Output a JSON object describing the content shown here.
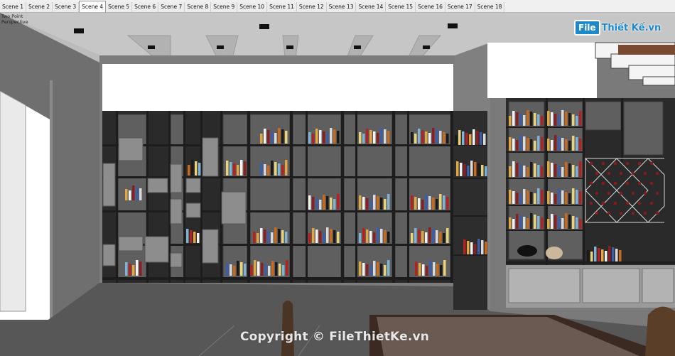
{
  "app": {
    "tabs": [
      "Scene 1",
      "Scene 2",
      "Scene 3",
      "Scene 4",
      "Scene 5",
      "Scene 6",
      "Scene 7",
      "Scene 8",
      "Scene 9",
      "Scene 10",
      "Scene 11",
      "Scene 12",
      "Scene 13",
      "Scene 14",
      "Scene 15",
      "Scene 16",
      "Scene 17",
      "Scene 18"
    ],
    "active_tab": "Scene 4"
  },
  "viewport": {
    "camera_label": "Two Point\nPerspective"
  },
  "watermark": {
    "text": "Copyright © FileThietKe.vn"
  },
  "logo": {
    "badge": "File",
    "text": "Thiết Kế.vn"
  },
  "colors": {
    "wall": "#7b7b7b",
    "ceiling": "#c9c9c9",
    "floor": "#555555",
    "cabinet": "#2c2c2c",
    "marble": "#6a6a6a",
    "white_soffit": "#ffffff",
    "accent": "#1e88c8"
  }
}
